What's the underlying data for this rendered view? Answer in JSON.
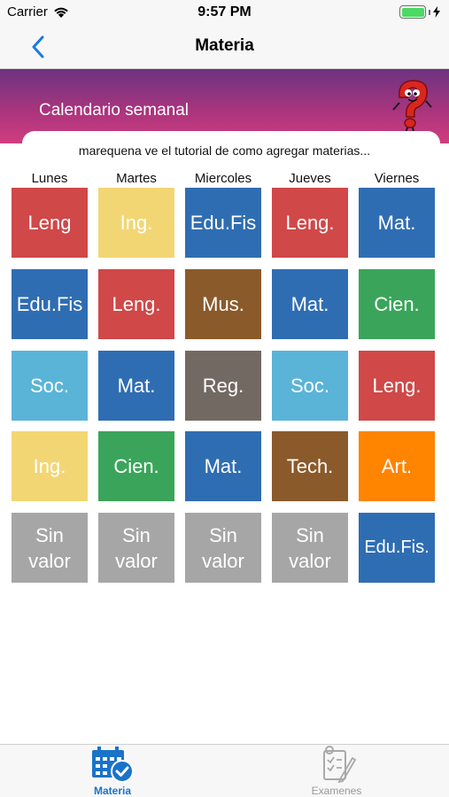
{
  "status": {
    "carrier": "Carrier",
    "time": "9:57 PM",
    "battery_level": 1.0
  },
  "nav": {
    "title": "Materia",
    "back_icon": "chevron-left-icon"
  },
  "banner": {
    "title": "Calendario semanal"
  },
  "hint": "marequena ve el tutorial de como agregar materias...",
  "days": [
    "Lunes",
    "Martes",
    "Miercoles",
    "Jueves",
    "Viernes"
  ],
  "colors": {
    "red": "#d04848",
    "yellow": "#f3d674",
    "blue": "#2f6db3",
    "brown": "#8b5a2b",
    "green": "#3aa55a",
    "light_blue": "#5ab4d8",
    "gray_brown": "#726a62",
    "orange": "#ff8400",
    "gray": "#a6a6a6"
  },
  "grid": [
    [
      "Leng",
      "Ing.",
      "Edu.Fis",
      "Leng.",
      "Mat."
    ],
    [
      "Edu.Fis",
      "Leng.",
      "Mus.",
      "Mat.",
      "Cien."
    ],
    [
      "Soc.",
      "Mat.",
      "Reg.",
      "Soc.",
      "Leng."
    ],
    [
      "Ing.",
      "Cien.",
      "Mat.",
      "Tech.",
      "Art."
    ],
    [
      "Sin\nvalor",
      "Sin\nvalor",
      "Sin\nvalor",
      "Sin\nvalor",
      "Edu.Fis."
    ]
  ],
  "tabs": [
    {
      "label": "Materia",
      "icon": "calendar-check-icon",
      "selected": true
    },
    {
      "label": "Examenes",
      "icon": "exam-sheet-icon",
      "selected": false
    }
  ]
}
